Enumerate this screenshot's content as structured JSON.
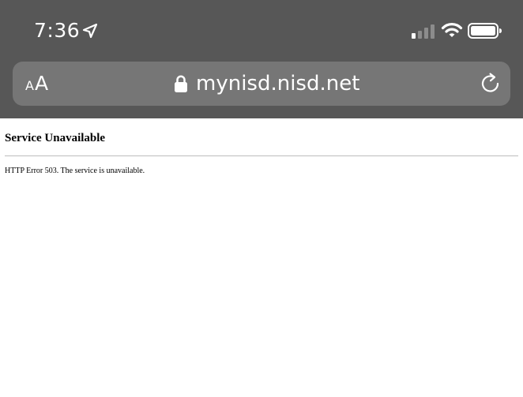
{
  "status_bar": {
    "time": "7:36",
    "location_icon": "location-arrow-icon",
    "signal_icon": "cellular-signal-icon",
    "wifi_icon": "wifi-icon",
    "battery_icon": "battery-icon",
    "signal_bars_active": 1,
    "signal_bars_total": 4
  },
  "address_bar": {
    "reader_small": "A",
    "reader_large": "A",
    "url": "mynisd.nisd.net",
    "lock_icon": "lock-icon",
    "reload_icon": "reload-icon"
  },
  "page": {
    "title": "Service Unavailable",
    "message": "HTTP Error 503. The service is unavailable."
  },
  "colors": {
    "chrome_background": "#575757",
    "address_bar_background": "#767676",
    "foreground": "#ffffff",
    "page_background": "#ffffff",
    "divider": "#bdbdbd"
  }
}
